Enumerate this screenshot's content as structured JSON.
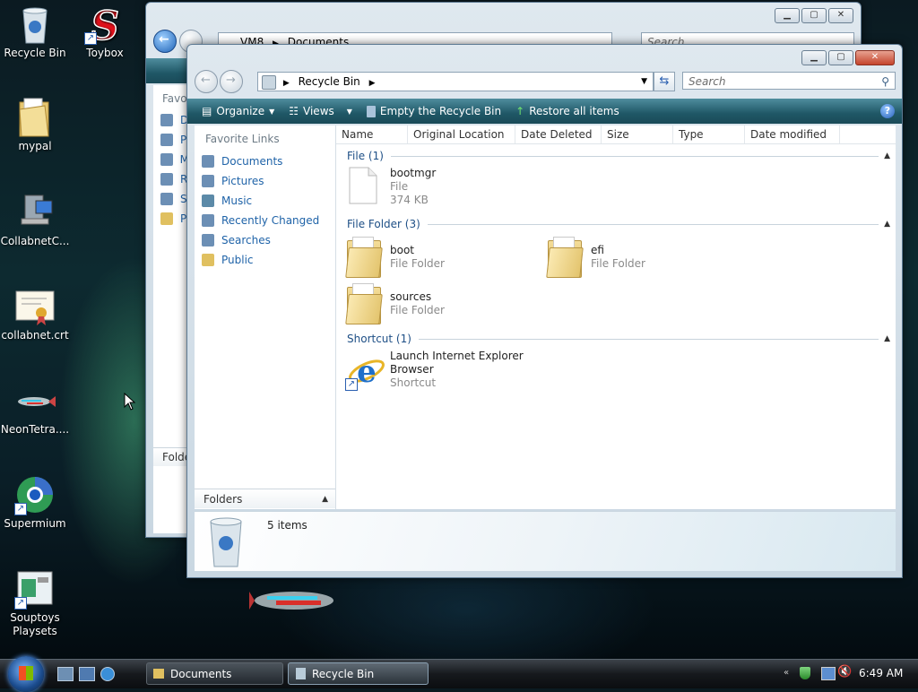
{
  "desktop": {
    "icons": [
      {
        "label": "Recycle Bin"
      },
      {
        "label": "Toybox"
      },
      {
        "label": "mypal"
      },
      {
        "label": "CollabnetC..."
      },
      {
        "label": "collabnet.crt"
      },
      {
        "label": "NeonTetra...."
      },
      {
        "label": "Supermium"
      },
      {
        "label": "Souptoys Playsets"
      }
    ]
  },
  "back_window": {
    "address": [
      "VM8",
      "Documents"
    ],
    "search_placeholder": "Search",
    "nav_heading": "Favorit",
    "nav_letters": [
      "D",
      "P",
      "M",
      "R",
      "S",
      "P"
    ],
    "folders_label": "Folde"
  },
  "recycle_window": {
    "address": "Recycle Bin",
    "search_placeholder": "Search",
    "toolbar": {
      "organize": "Organize",
      "views": "Views",
      "empty": "Empty the Recycle Bin",
      "restore": "Restore all items",
      "help": "?"
    },
    "favorite_links_header": "Favorite Links",
    "favorite_links": [
      {
        "label": "Documents",
        "icon": "documents-icon"
      },
      {
        "label": "Pictures",
        "icon": "pictures-icon"
      },
      {
        "label": "Music",
        "icon": "music-icon"
      },
      {
        "label": "Recently Changed",
        "icon": "recently-changed-icon"
      },
      {
        "label": "Searches",
        "icon": "searches-icon"
      },
      {
        "label": "Public",
        "icon": "folder-icon"
      }
    ],
    "folders_label": "Folders",
    "columns": [
      "Name",
      "Original Location",
      "Date Deleted",
      "Size",
      "Type",
      "Date modified"
    ],
    "groups": [
      {
        "title": "File (1)"
      },
      {
        "title": "File Folder (3)"
      },
      {
        "title": "Shortcut (1)"
      }
    ],
    "items": {
      "bootmgr": {
        "name": "bootmgr",
        "type": "File",
        "size": "374 KB"
      },
      "boot": {
        "name": "boot",
        "type": "File Folder"
      },
      "efi": {
        "name": "efi",
        "type": "File Folder"
      },
      "sources": {
        "name": "sources",
        "type": "File Folder"
      },
      "ie": {
        "name1": "Launch Internet Explorer",
        "name2": "Browser",
        "type": "Shortcut"
      }
    },
    "status": "5 items"
  },
  "taskbar": {
    "buttons": [
      {
        "label": "Documents"
      },
      {
        "label": "Recycle Bin"
      }
    ],
    "clock": "6:49 AM"
  },
  "colors": {
    "link": "#1f63a8",
    "group_header": "#1e4f86",
    "command_bar": "#1f5766"
  }
}
